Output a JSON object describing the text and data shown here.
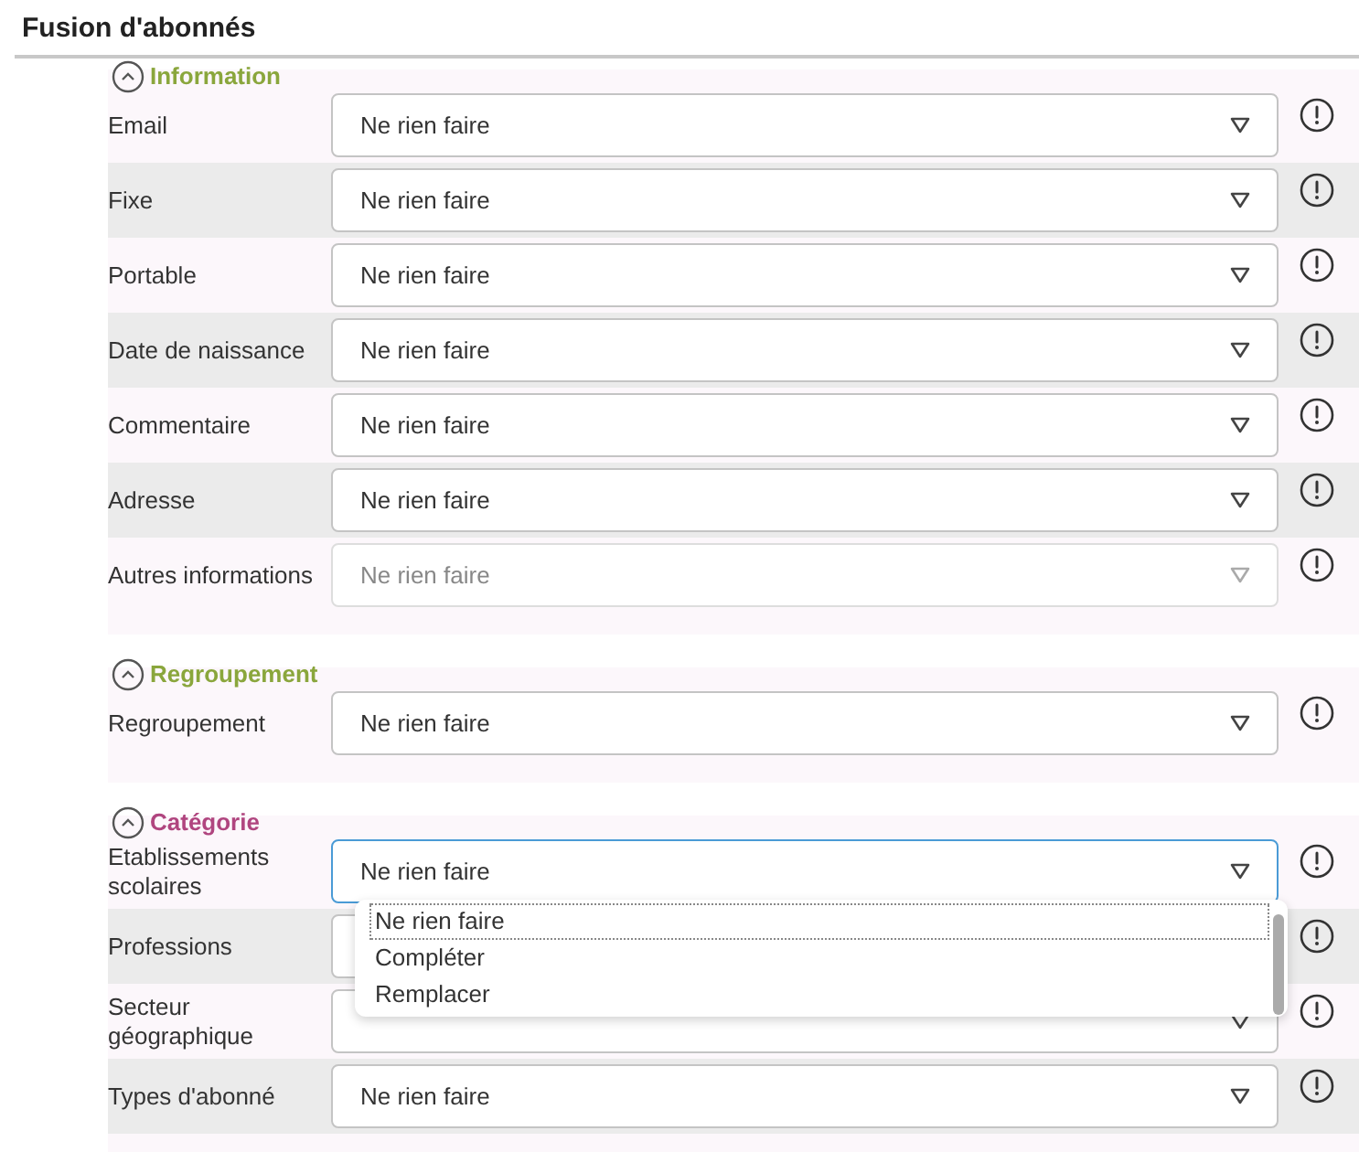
{
  "title": "Fusion d'abonnés",
  "sections": [
    {
      "title": "Information",
      "color": "#8aa63c",
      "expanded": true,
      "fields": [
        {
          "label": "Email",
          "value": "Ne rien faire",
          "disabled": false,
          "open": false
        },
        {
          "label": "Fixe",
          "value": "Ne rien faire",
          "disabled": false,
          "open": false
        },
        {
          "label": "Portable",
          "value": "Ne rien faire",
          "disabled": false,
          "open": false
        },
        {
          "label": "Date de naissance",
          "value": "Ne rien faire",
          "disabled": false,
          "open": false
        },
        {
          "label": "Commentaire",
          "value": "Ne rien faire",
          "disabled": false,
          "open": false
        },
        {
          "label": "Adresse",
          "value": "Ne rien faire",
          "disabled": false,
          "open": false
        },
        {
          "label": "Autres informations",
          "value": "Ne rien faire",
          "disabled": true,
          "open": false
        }
      ]
    },
    {
      "title": "Regroupement",
      "color": "#8aa63c",
      "expanded": true,
      "fields": [
        {
          "label": "Regroupement",
          "value": "Ne rien faire",
          "disabled": false,
          "open": false
        }
      ]
    },
    {
      "title": "Catégorie",
      "color": "#b0457f",
      "expanded": true,
      "fields": [
        {
          "label": "Etablissements scolaires",
          "value": "Ne rien faire",
          "disabled": false,
          "open": true,
          "options": [
            {
              "label": "Ne rien faire",
              "selected": true
            },
            {
              "label": "Compléter",
              "selected": false
            },
            {
              "label": "Remplacer",
              "selected": false
            }
          ]
        },
        {
          "label": "Professions",
          "disabled": false,
          "open": false
        },
        {
          "label": "Secteur géographique",
          "disabled": false,
          "open": false
        },
        {
          "label": "Types d'abonné",
          "value": "Ne rien faire",
          "disabled": false,
          "open": false
        }
      ]
    }
  ]
}
